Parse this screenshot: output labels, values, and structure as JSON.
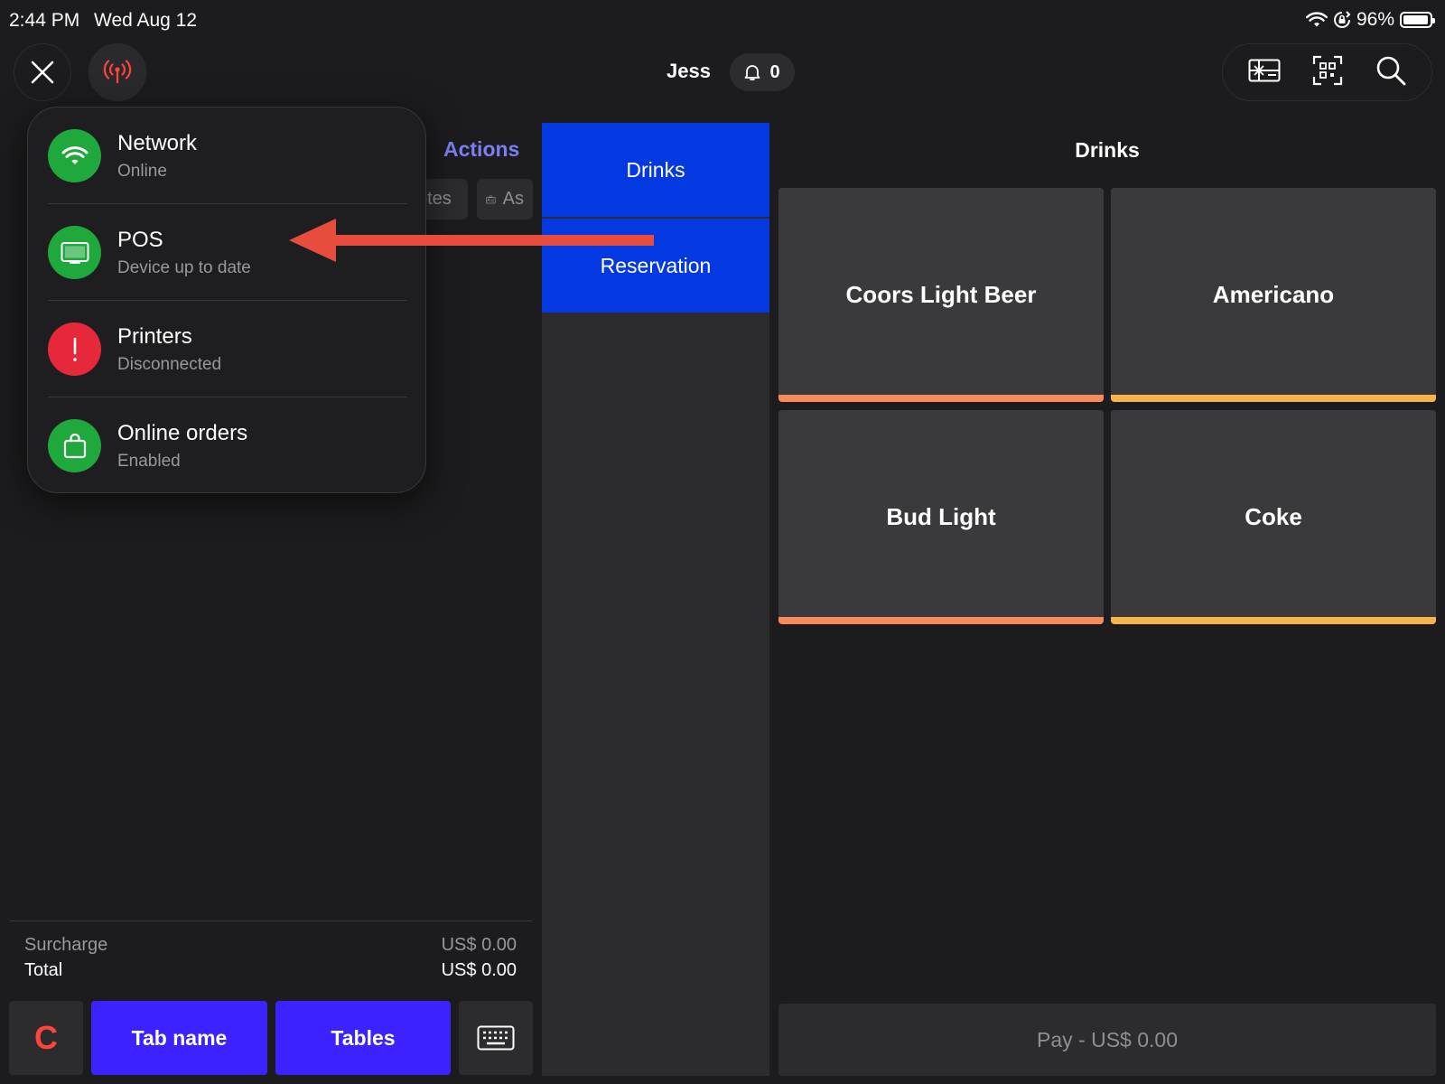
{
  "status_bar": {
    "time": "2:44 PM",
    "date": "Wed Aug 12",
    "battery": "96%",
    "battery_level": 0.96,
    "icons": [
      "wifi-icon",
      "orientation-lock-icon",
      "battery-icon"
    ]
  },
  "header": {
    "user": "Jess",
    "notifications": "0",
    "icons": [
      "close-icon",
      "broadcast-icon",
      "bell-icon",
      "gift-card-icon",
      "qr-scan-icon",
      "search-icon"
    ]
  },
  "order_panel": {
    "actions_tab": "Actions",
    "chips": [
      "otes",
      "As"
    ],
    "surcharge_label": "Surcharge",
    "surcharge_value": "US$ 0.00",
    "total_label": "Total",
    "total_value": "US$ 0.00",
    "buttons": {
      "clear": "C",
      "tab_name": "Tab name",
      "tables": "Tables"
    }
  },
  "categories": [
    {
      "label": "Drinks"
    },
    {
      "label": "Reservation"
    }
  ],
  "products": {
    "title": "Drinks",
    "items": [
      {
        "label": "Coors Light Beer",
        "color": "#f98b5b"
      },
      {
        "label": "Americano",
        "color": "#f5b34a"
      },
      {
        "label": "Bud Light",
        "color": "#f98b5b"
      },
      {
        "label": "Coke",
        "color": "#f5b34a"
      }
    ],
    "pay_label": "Pay - US$ 0.00"
  },
  "status_popover": {
    "items": [
      {
        "title": "Network",
        "subtitle": "Online",
        "color": "#1fa83b",
        "icon": "wifi-icon"
      },
      {
        "title": "POS",
        "subtitle": "Device up to date",
        "color": "#1fa83b",
        "icon": "monitor-icon"
      },
      {
        "title": "Printers",
        "subtitle": "Disconnected",
        "color": "#e5283a",
        "icon": "alert-icon"
      },
      {
        "title": "Online orders",
        "subtitle": "Enabled",
        "color": "#1fa83b",
        "icon": "shopping-bag-icon"
      }
    ]
  },
  "colors": {
    "accent_blue": "#0438e0",
    "accent_purple": "#3b22ff",
    "annotation_arrow": "#e74c3c"
  }
}
